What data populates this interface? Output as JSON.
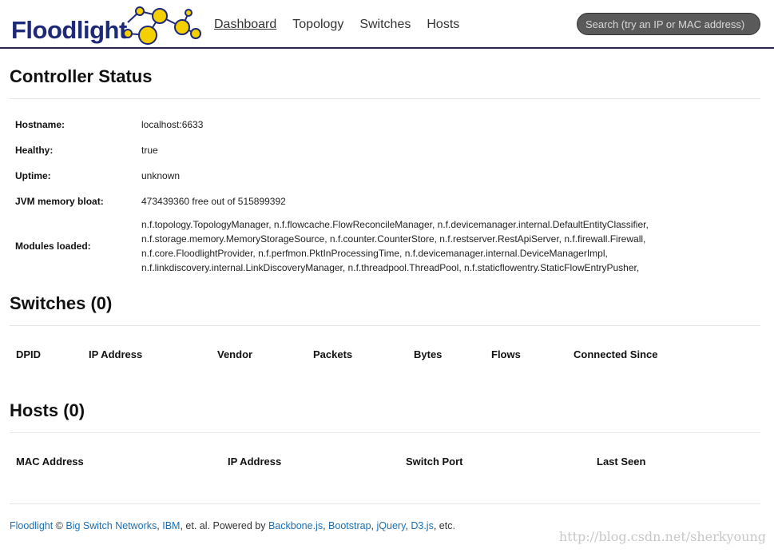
{
  "header": {
    "brand": "Floodlight",
    "nav": [
      "Dashboard",
      "Topology",
      "Switches",
      "Hosts"
    ],
    "active_nav": "Dashboard",
    "search_placeholder": "Search (try an IP or MAC address)"
  },
  "controller": {
    "title": "Controller Status",
    "rows": [
      {
        "label": "Hostname:",
        "value": "localhost:6633"
      },
      {
        "label": "Healthy:",
        "value": "true"
      },
      {
        "label": "Uptime:",
        "value": "unknown"
      },
      {
        "label": "JVM memory bloat:",
        "value": "473439360 free out of 515899392"
      }
    ],
    "modules_label": "Modules loaded:",
    "modules_lines": [
      "n.f.topology.TopologyManager, n.f.flowcache.FlowReconcileManager, n.f.devicemanager.internal.DefaultEntityClassifier,",
      "n.f.storage.memory.MemoryStorageSource, n.f.counter.CounterStore, n.f.restserver.RestApiServer, n.f.firewall.Firewall,",
      "n.f.core.FloodlightProvider, n.f.perfmon.PktInProcessingTime, n.f.devicemanager.internal.DeviceManagerImpl,",
      "n.f.linkdiscovery.internal.LinkDiscoveryManager, n.f.threadpool.ThreadPool, n.f.staticflowentry.StaticFlowEntryPusher,"
    ]
  },
  "switches": {
    "title": "Switches (0)",
    "columns": [
      "DPID",
      "IP Address",
      "Vendor",
      "Packets",
      "Bytes",
      "Flows",
      "Connected Since"
    ]
  },
  "hosts": {
    "title": "Hosts (0)",
    "columns": [
      "MAC Address",
      "IP Address",
      "Switch Port",
      "Last Seen"
    ]
  },
  "footer": {
    "floodlight": "Floodlight",
    "copyright": " © ",
    "bsn": "Big Switch Networks",
    "sep1": ", ",
    "ibm": "IBM",
    "mid": ", et. al. Powered by ",
    "backbone": "Backbone.js",
    "sep2": ", ",
    "bootstrap": "Bootstrap",
    "sep3": ", ",
    "jquery": "jQuery",
    "sep4": ", ",
    "d3": "D3.js",
    "end": ", etc."
  },
  "watermark": "http://blog.csdn.net/sherkyoung",
  "colors": {
    "brand": "#1e2a78",
    "link": "#1a6fb5",
    "bulb": "#f5d000",
    "header_rule": "#2c2550"
  }
}
